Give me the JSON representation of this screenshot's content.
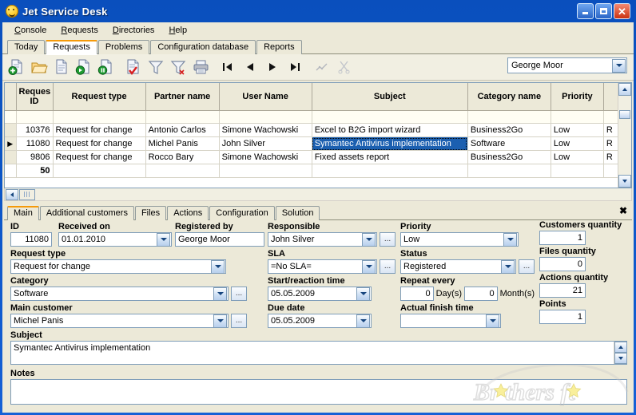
{
  "window": {
    "title": "Jet Service Desk",
    "icon": "smiley-icon",
    "minimize_label": "Minimize",
    "maximize_label": "Maximize",
    "close_label": "Close"
  },
  "menu": [
    {
      "label": "Console",
      "accel": "C"
    },
    {
      "label": "Requests",
      "accel": "R"
    },
    {
      "label": "Directories",
      "accel": "D"
    },
    {
      "label": "Help",
      "accel": "H"
    }
  ],
  "tabs": [
    {
      "label": "Today",
      "active": false
    },
    {
      "label": "Requests",
      "active": true
    },
    {
      "label": "Problems",
      "active": false
    },
    {
      "label": "Configuration database",
      "active": false
    },
    {
      "label": "Reports",
      "active": false
    }
  ],
  "toolbar": {
    "buttons": [
      {
        "name": "new-request-icon",
        "title": "New"
      },
      {
        "name": "open-folder-icon",
        "title": "Open"
      },
      {
        "name": "copy-document-icon",
        "title": "Copy"
      },
      {
        "name": "start-request-icon",
        "title": "Start"
      },
      {
        "name": "pause-request-icon",
        "title": "Pause"
      },
      {
        "name": "close-request-icon",
        "title": "Close request"
      },
      {
        "name": "filter-icon",
        "title": "Filter"
      },
      {
        "name": "clear-filter-icon",
        "title": "Clear filter"
      },
      {
        "name": "print-icon",
        "title": "Print"
      },
      {
        "name": "nav-first-icon",
        "title": "First"
      },
      {
        "name": "nav-prev-icon",
        "title": "Previous"
      },
      {
        "name": "nav-next-icon",
        "title": "Next"
      },
      {
        "name": "nav-last-icon",
        "title": "Last"
      },
      {
        "name": "chart-icon",
        "title": "Chart"
      },
      {
        "name": "cut-icon",
        "title": "Cut"
      }
    ],
    "user_combo": {
      "value": "George Moor",
      "placeholder": ""
    }
  },
  "grid": {
    "columns": [
      "Reques ID",
      "Request type",
      "Partner name",
      "User Name",
      "Subject",
      "Category name",
      "Priority",
      "R"
    ],
    "filter_row": [
      "",
      "",
      "",
      "",
      "",
      "",
      "",
      ""
    ],
    "rows": [
      {
        "current": false,
        "id": "10376",
        "request_type": "Request for change",
        "partner_name": "Antonio Carlos",
        "user_name": "Simone Wachowski",
        "subject": "Excel to B2G import wizard",
        "category_name": "Business2Go",
        "priority": "Low",
        "extra": "R",
        "selected": false
      },
      {
        "current": true,
        "id": "11080",
        "request_type": "Request for change",
        "partner_name": "Michel Panis",
        "user_name": "John Silver",
        "subject": "Symantec Antivirus implementation",
        "category_name": "Software",
        "priority": "Low",
        "extra": "R",
        "selected": true
      },
      {
        "current": false,
        "id": "9806",
        "request_type": "Request for change",
        "partner_name": "Rocco Bary",
        "user_name": "Simone Wachowski",
        "subject": "Fixed assets report",
        "category_name": "Business2Go",
        "priority": "Low",
        "extra": "R",
        "selected": false
      }
    ],
    "summary": {
      "count": "50"
    }
  },
  "detail": {
    "tabs": [
      {
        "label": "Main",
        "active": true
      },
      {
        "label": "Additional customers",
        "active": false
      },
      {
        "label": "Files",
        "active": false
      },
      {
        "label": "Actions",
        "active": false
      },
      {
        "label": "Configuration",
        "active": false
      },
      {
        "label": "Solution",
        "active": false
      }
    ],
    "close_label": "✖",
    "fields": {
      "id": {
        "label": "ID",
        "value": "11080"
      },
      "received_on": {
        "label": "Received on",
        "value": "01.01.2010"
      },
      "registered_by": {
        "label": "Registered by",
        "value": "George Moor"
      },
      "responsible": {
        "label": "Responsible",
        "value": "John Silver"
      },
      "priority": {
        "label": "Priority",
        "value": "Low"
      },
      "request_type": {
        "label": "Request type",
        "value": "Request for change"
      },
      "sla": {
        "label": "SLA",
        "value": "=No SLA="
      },
      "status": {
        "label": "Status",
        "value": "Registered"
      },
      "category": {
        "label": "Category",
        "value": "Software"
      },
      "start_reaction_time": {
        "label": "Start/reaction time",
        "value": "05.05.2009"
      },
      "repeat_every": {
        "label": "Repeat every",
        "days_value": "0",
        "days_suffix": "Day(s)",
        "months_value": "0",
        "months_suffix": "Month(s)"
      },
      "main_customer": {
        "label": "Main customer",
        "value": "Michel Panis"
      },
      "due_date": {
        "label": "Due date",
        "value": "05.05.2009"
      },
      "actual_finish_time": {
        "label": "Actual finish time",
        "value": ""
      },
      "customers_quantity": {
        "label": "Customers quantity",
        "value": "1"
      },
      "files_quantity": {
        "label": "Files quantity",
        "value": "0"
      },
      "actions_quantity": {
        "label": "Actions quantity",
        "value": "21"
      },
      "points": {
        "label": "Points",
        "value": "1"
      },
      "subject": {
        "label": "Subject",
        "value": "Symantec Antivirus implementation"
      },
      "notes": {
        "label": "Notes",
        "value": ""
      }
    },
    "ellipsis_label": "..."
  },
  "watermark": {
    "text": "Brothersoft"
  },
  "colors": {
    "titlebar": "#0b55c6",
    "accent_tab": "#f59a0a",
    "selection": "#1b5fb0",
    "face": "#ece9d8",
    "field_border": "#7f9db9"
  }
}
